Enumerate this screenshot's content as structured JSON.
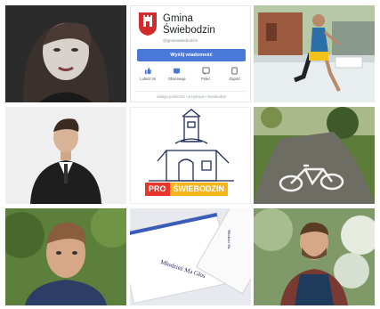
{
  "profile": {
    "page_name": "Gmina\nŚwiebodzin",
    "handle": "@gminaswiebodzin",
    "message_button": "Wyślij wiadomość",
    "actions": [
      {
        "label": "Lubisz to!",
        "icon": "like-icon"
      },
      {
        "label": "Obserwuje",
        "icon": "follow-icon"
      },
      {
        "label": "Poleć",
        "icon": "recommend-icon"
      },
      {
        "label": "Zapisz",
        "icon": "save-icon"
      }
    ],
    "category": "Usługa publiczna i urzędowa • Świebodzin"
  },
  "logo": {
    "prefix": "PRO",
    "name": "ŚWIEBODZIN"
  },
  "card_text": {
    "main": "Młodzież Ma Głos",
    "side": "Młodzież Ma"
  },
  "colors": {
    "accent": "#4a78d9",
    "pro_red": "#e8352b",
    "pro_yellow": "#f6b41a"
  }
}
